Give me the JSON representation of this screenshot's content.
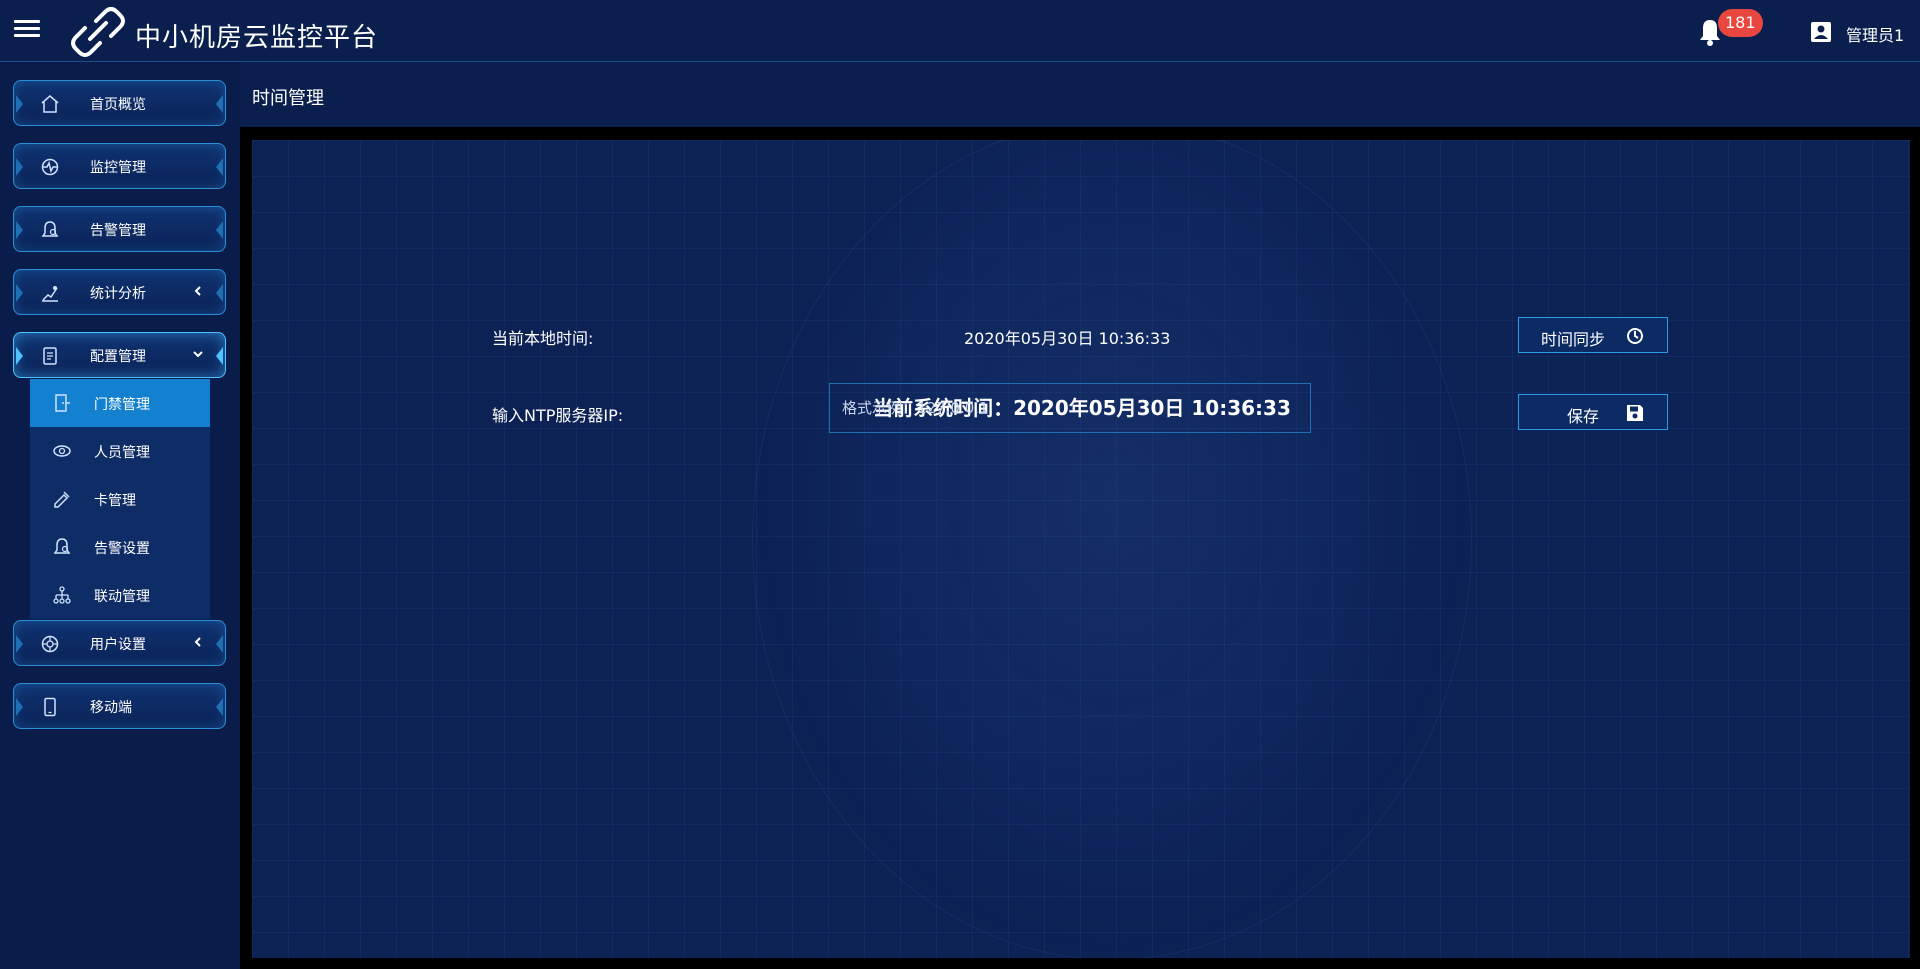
{
  "header": {
    "app_title": "中小机房云监控平台",
    "notification_count": "181",
    "user_name": "管理员1"
  },
  "sidebar": {
    "items": [
      {
        "label": "首页概览",
        "icon": "home-icon"
      },
      {
        "label": "监控管理",
        "icon": "monitor-icon"
      },
      {
        "label": "告警管理",
        "icon": "alarm-icon"
      },
      {
        "label": "统计分析",
        "icon": "statistics-icon",
        "expandable": true,
        "expanded": false
      },
      {
        "label": "配置管理",
        "icon": "config-icon",
        "expandable": true,
        "expanded": true
      },
      {
        "label": "用户设置",
        "icon": "user-settings-icon",
        "expandable": true,
        "expanded": false
      },
      {
        "label": "移动端",
        "icon": "mobile-icon"
      }
    ],
    "config_submenu": [
      {
        "label": "门禁管理",
        "icon": "door-icon",
        "active": true
      },
      {
        "label": "人员管理",
        "icon": "people-icon"
      },
      {
        "label": "卡管理",
        "icon": "card-icon"
      },
      {
        "label": "告警设置",
        "icon": "alarm-settings-icon"
      },
      {
        "label": "联动管理",
        "icon": "linkage-icon"
      }
    ]
  },
  "page": {
    "title": "时间管理",
    "system_time": "当前系统时间：2020年05月30日 10:36:33",
    "local_time_label": "当前本地时间:",
    "local_time_value": "2020年05月30日 10:36:33",
    "sync_button": "时间同步",
    "ntp_label": "输入NTP服务器IP:",
    "ntp_placeholder": "格式示例：127.0.0.1",
    "ntp_value": "",
    "save_button": "保存"
  },
  "colors": {
    "background": "#0a1d4a",
    "panel": "#0c2154",
    "accent_border": "#2a8fd4",
    "active_submenu": "#1480d0",
    "badge": "#e8463f"
  }
}
